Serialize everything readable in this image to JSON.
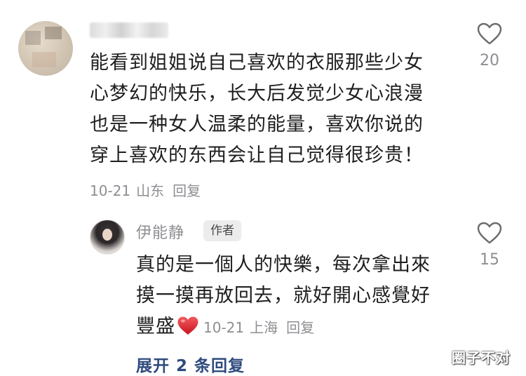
{
  "comment": {
    "username": "",
    "lines": [
      "能看到姐姐说自己喜欢的衣服那些少女",
      "心梦幻的快乐，长大后发觉少女心浪漫",
      "也是一种女人温柔的能量，喜欢你说的",
      "穿上喜欢的东西会让自己觉得很珍贵！"
    ],
    "date": "10-21",
    "location": "山东",
    "reply_label": "回复",
    "like_count": "20",
    "like_icon": "heart-outline-icon"
  },
  "reply": {
    "author": "伊能静",
    "author_badge": "作者",
    "lines": [
      "真的是一個人的快樂，每次拿出來",
      "摸一摸再放回去，就好開心感覺好",
      "豐盛"
    ],
    "emoji": "red-heart-emoji",
    "date": "10-21",
    "location": "上海",
    "reply_label": "回复",
    "like_count": "15",
    "like_icon": "heart-outline-icon"
  },
  "expand_label": "展开 2 条回复",
  "watermark": "圈子不对",
  "colors": {
    "text": "#1e1e1e",
    "meta": "#8e8e93",
    "link": "#2f4b7e",
    "heart_red": "#e0212f"
  }
}
